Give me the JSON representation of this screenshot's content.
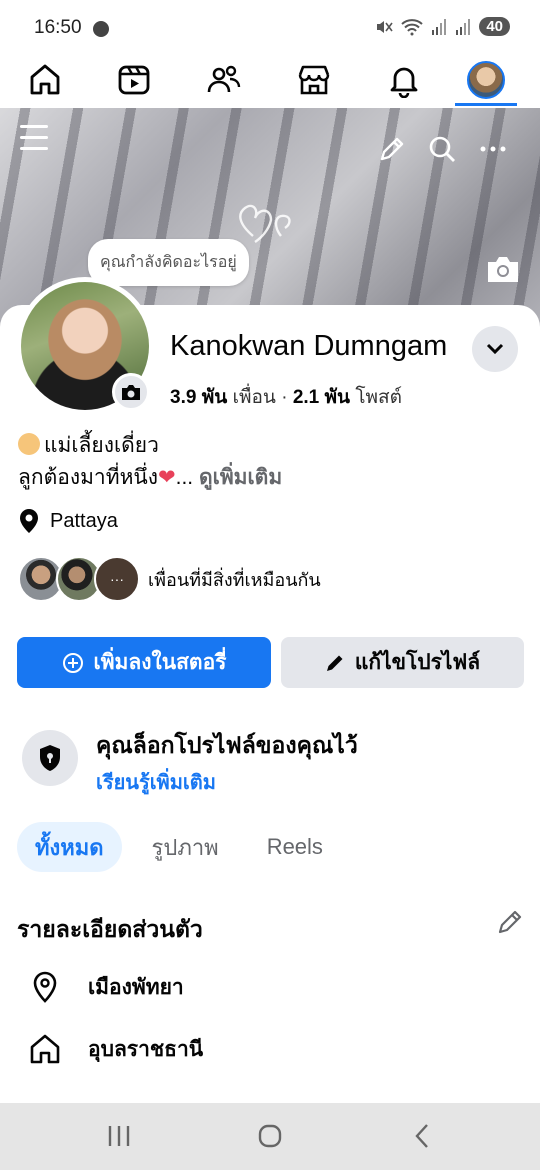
{
  "status_bar": {
    "time": "16:50",
    "battery": "40"
  },
  "nav": {
    "items": [
      "home",
      "watch",
      "friends",
      "marketplace",
      "notifications",
      "profile"
    ],
    "active": "profile"
  },
  "cover": {
    "thought_bubble": "คุณกำลังคิดอะไรอยู่"
  },
  "profile": {
    "name": "Kanokwan Dumngam",
    "friends_count": "3.9 พัน",
    "friends_label": "เพื่อน",
    "separator": "·",
    "posts_count": "2.1 พัน",
    "posts_label": "โพสต์"
  },
  "bio": {
    "line1": "แม่เลี้ยงเดี่ยว",
    "line2": "ลูกต้องมาที่หนึ่ง",
    "heart": "❤",
    "ellipsis": "...",
    "see_more": "ดูเพิ่มเติม"
  },
  "location": "Pattaya",
  "mutual": {
    "text": "เพื่อนที่มีสิ่งที่เหมือนกัน",
    "more": "···"
  },
  "buttons": {
    "add_story": "เพิ่มลงในสตอรี่",
    "edit_profile": "แก้ไขโปรไฟล์"
  },
  "lock_notice": {
    "title": "คุณล็อกโปรไฟล์ของคุณไว้",
    "learn_more": "เรียนรู้เพิ่มเติม"
  },
  "tabs": [
    {
      "label": "ทั้งหมด",
      "active": true
    },
    {
      "label": "รูปภาพ",
      "active": false
    },
    {
      "label": "Reels",
      "active": false
    }
  ],
  "details": {
    "title": "รายละเอียดส่วนตัว",
    "items": [
      {
        "icon": "location-pin-icon",
        "text": "เมืองพัทยา"
      },
      {
        "icon": "home-icon",
        "text": "อุบลราชธานี"
      }
    ]
  },
  "colors": {
    "accent": "#1877f2",
    "light_accent": "#e7f3ff",
    "gray_button": "#e4e6eb"
  }
}
